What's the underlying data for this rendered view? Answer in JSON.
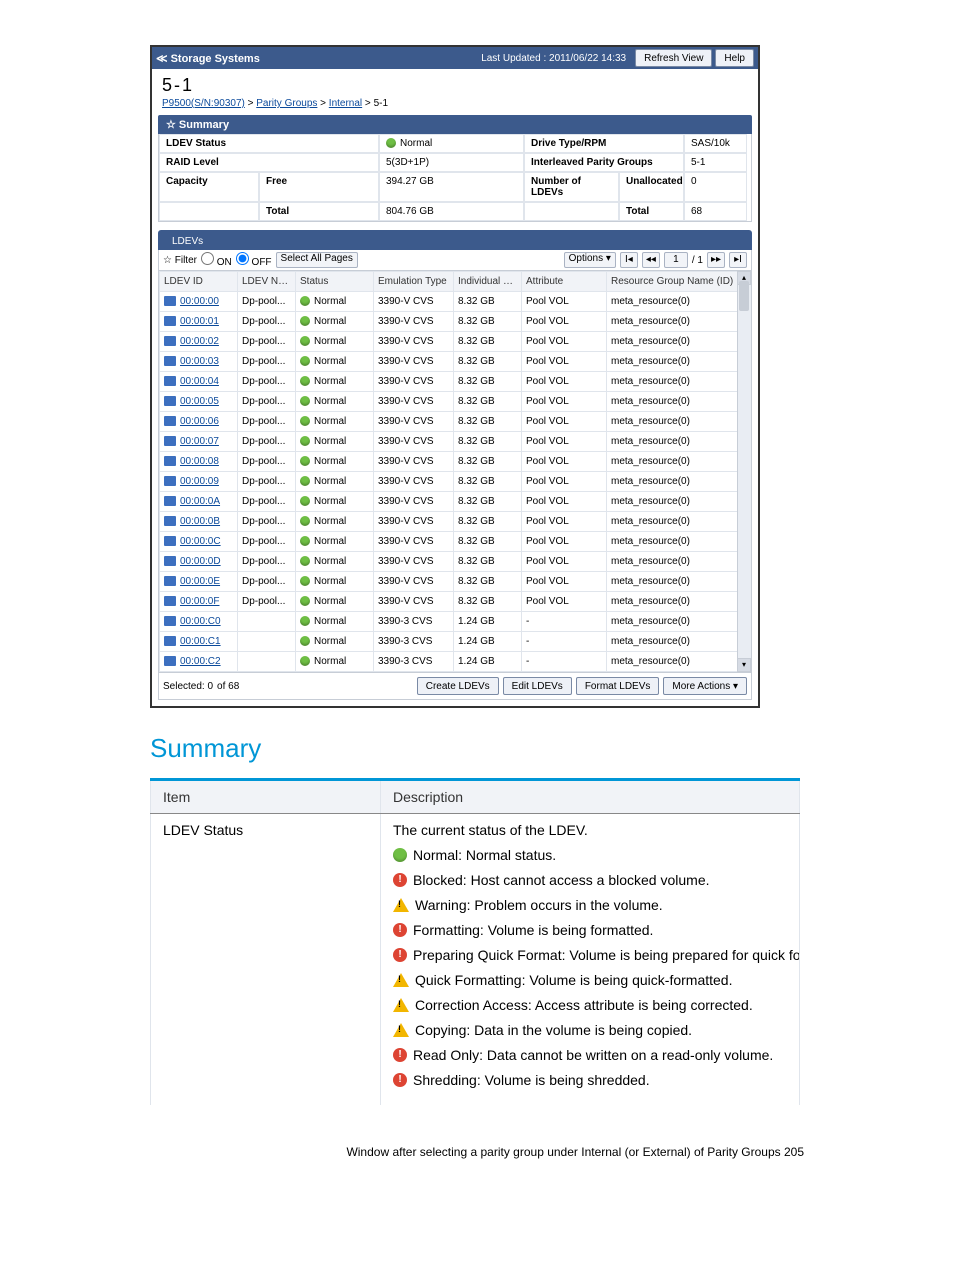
{
  "topbar": {
    "back": "≪ Storage Systems",
    "last_updated": "Last Updated : 2011/06/22 14:33",
    "refresh": "Refresh View",
    "help": "Help"
  },
  "heading": "5-1",
  "crumbs": {
    "a": "P9500(S/N:90307)",
    "b": "Parity Groups",
    "c": "Internal",
    "d": "5-1"
  },
  "summary_hdr": "Summary",
  "summary": {
    "ldev_status_lbl": "LDEV Status",
    "ldev_status_val": "Normal",
    "drive_type_lbl": "Drive Type/RPM",
    "drive_type_val": "SAS/10k",
    "raid_lbl": "RAID Level",
    "raid_val": "5(3D+1P)",
    "interleaved_lbl": "Interleaved Parity Groups",
    "interleaved_val": "5-1",
    "capacity_lbl": "Capacity",
    "free_lbl": "Free",
    "free_val": "394.27 GB",
    "num_ldevs_lbl": "Number of LDEVs",
    "unalloc_lbl": "Unallocated",
    "unalloc_val": "0",
    "total_lbl": "Total",
    "total_val": "804.76 GB",
    "total_lbl2": "Total",
    "total_val2": "68"
  },
  "tab": "LDEVs",
  "filter": {
    "label": "Filter",
    "on": "ON",
    "off": "OFF",
    "select_all": "Select All Pages",
    "options": "Options ▾",
    "page": "1",
    "page_total": "/ 1"
  },
  "cols": {
    "c1": "LDEV ID",
    "c2": "LDEV Name",
    "c3": "Status",
    "c4": "Emulation Type",
    "c5": "Individual Capacity",
    "c6": "Attribute",
    "c7": "Resource Group Name (ID)"
  },
  "rows": [
    {
      "id": "00:00:00",
      "name": "Dp-pool...",
      "status": "Normal",
      "emul": "3390-V CVS",
      "cap": "8.32 GB",
      "attr": "Pool VOL",
      "rg": "meta_resource(0)"
    },
    {
      "id": "00:00:01",
      "name": "Dp-pool...",
      "status": "Normal",
      "emul": "3390-V CVS",
      "cap": "8.32 GB",
      "attr": "Pool VOL",
      "rg": "meta_resource(0)"
    },
    {
      "id": "00:00:02",
      "name": "Dp-pool...",
      "status": "Normal",
      "emul": "3390-V CVS",
      "cap": "8.32 GB",
      "attr": "Pool VOL",
      "rg": "meta_resource(0)"
    },
    {
      "id": "00:00:03",
      "name": "Dp-pool...",
      "status": "Normal",
      "emul": "3390-V CVS",
      "cap": "8.32 GB",
      "attr": "Pool VOL",
      "rg": "meta_resource(0)"
    },
    {
      "id": "00:00:04",
      "name": "Dp-pool...",
      "status": "Normal",
      "emul": "3390-V CVS",
      "cap": "8.32 GB",
      "attr": "Pool VOL",
      "rg": "meta_resource(0)"
    },
    {
      "id": "00:00:05",
      "name": "Dp-pool...",
      "status": "Normal",
      "emul": "3390-V CVS",
      "cap": "8.32 GB",
      "attr": "Pool VOL",
      "rg": "meta_resource(0)"
    },
    {
      "id": "00:00:06",
      "name": "Dp-pool...",
      "status": "Normal",
      "emul": "3390-V CVS",
      "cap": "8.32 GB",
      "attr": "Pool VOL",
      "rg": "meta_resource(0)"
    },
    {
      "id": "00:00:07",
      "name": "Dp-pool...",
      "status": "Normal",
      "emul": "3390-V CVS",
      "cap": "8.32 GB",
      "attr": "Pool VOL",
      "rg": "meta_resource(0)"
    },
    {
      "id": "00:00:08",
      "name": "Dp-pool...",
      "status": "Normal",
      "emul": "3390-V CVS",
      "cap": "8.32 GB",
      "attr": "Pool VOL",
      "rg": "meta_resource(0)"
    },
    {
      "id": "00:00:09",
      "name": "Dp-pool...",
      "status": "Normal",
      "emul": "3390-V CVS",
      "cap": "8.32 GB",
      "attr": "Pool VOL",
      "rg": "meta_resource(0)"
    },
    {
      "id": "00:00:0A",
      "name": "Dp-pool...",
      "status": "Normal",
      "emul": "3390-V CVS",
      "cap": "8.32 GB",
      "attr": "Pool VOL",
      "rg": "meta_resource(0)"
    },
    {
      "id": "00:00:0B",
      "name": "Dp-pool...",
      "status": "Normal",
      "emul": "3390-V CVS",
      "cap": "8.32 GB",
      "attr": "Pool VOL",
      "rg": "meta_resource(0)"
    },
    {
      "id": "00:00:0C",
      "name": "Dp-pool...",
      "status": "Normal",
      "emul": "3390-V CVS",
      "cap": "8.32 GB",
      "attr": "Pool VOL",
      "rg": "meta_resource(0)"
    },
    {
      "id": "00:00:0D",
      "name": "Dp-pool...",
      "status": "Normal",
      "emul": "3390-V CVS",
      "cap": "8.32 GB",
      "attr": "Pool VOL",
      "rg": "meta_resource(0)"
    },
    {
      "id": "00:00:0E",
      "name": "Dp-pool...",
      "status": "Normal",
      "emul": "3390-V CVS",
      "cap": "8.32 GB",
      "attr": "Pool VOL",
      "rg": "meta_resource(0)"
    },
    {
      "id": "00:00:0F",
      "name": "Dp-pool...",
      "status": "Normal",
      "emul": "3390-V CVS",
      "cap": "8.32 GB",
      "attr": "Pool VOL",
      "rg": "meta_resource(0)"
    },
    {
      "id": "00:00:C0",
      "name": "",
      "status": "Normal",
      "emul": "3390-3 CVS",
      "cap": "1.24 GB",
      "attr": "-",
      "rg": "meta_resource(0)"
    },
    {
      "id": "00:00:C1",
      "name": "",
      "status": "Normal",
      "emul": "3390-3 CVS",
      "cap": "1.24 GB",
      "attr": "-",
      "rg": "meta_resource(0)"
    },
    {
      "id": "00:00:C2",
      "name": "",
      "status": "Normal",
      "emul": "3390-3 CVS",
      "cap": "1.24 GB",
      "attr": "-",
      "rg": "meta_resource(0)"
    }
  ],
  "footbar": {
    "selected": "Selected:  0",
    "of": "of  68",
    "create": "Create LDEVs",
    "edit": "Edit LDEVs",
    "format": "Format LDEVs",
    "more": "More Actions ▾"
  },
  "doc": {
    "heading": "Summary",
    "th_item": "Item",
    "th_desc": "Description",
    "row_label": "LDEV Status",
    "intro": "The current status of the LDEV.",
    "statuses": [
      {
        "ic": "green",
        "txt": "Normal: Normal status."
      },
      {
        "ic": "red",
        "txt": "Blocked: Host cannot access a blocked volume."
      },
      {
        "ic": "yellow",
        "txt": "Warning: Problem occurs in the volume."
      },
      {
        "ic": "red",
        "txt": "Formatting: Volume is being formatted."
      },
      {
        "ic": "red",
        "txt": "Preparing Quick Format: Volume is being prepared for quick formatting."
      },
      {
        "ic": "yellow",
        "txt": "Quick Formatting: Volume is being quick-formatted."
      },
      {
        "ic": "yellow",
        "txt": "Correction Access: Access attribute is being corrected."
      },
      {
        "ic": "yellow",
        "txt": "Copying: Data in the volume is being copied."
      },
      {
        "ic": "red",
        "txt": "Read Only: Data cannot be written on a read-only volume."
      },
      {
        "ic": "red",
        "txt": "Shredding: Volume is being shredded."
      }
    ]
  },
  "footer": "Window after selecting a parity group under Internal (or External) of Parity Groups   205"
}
